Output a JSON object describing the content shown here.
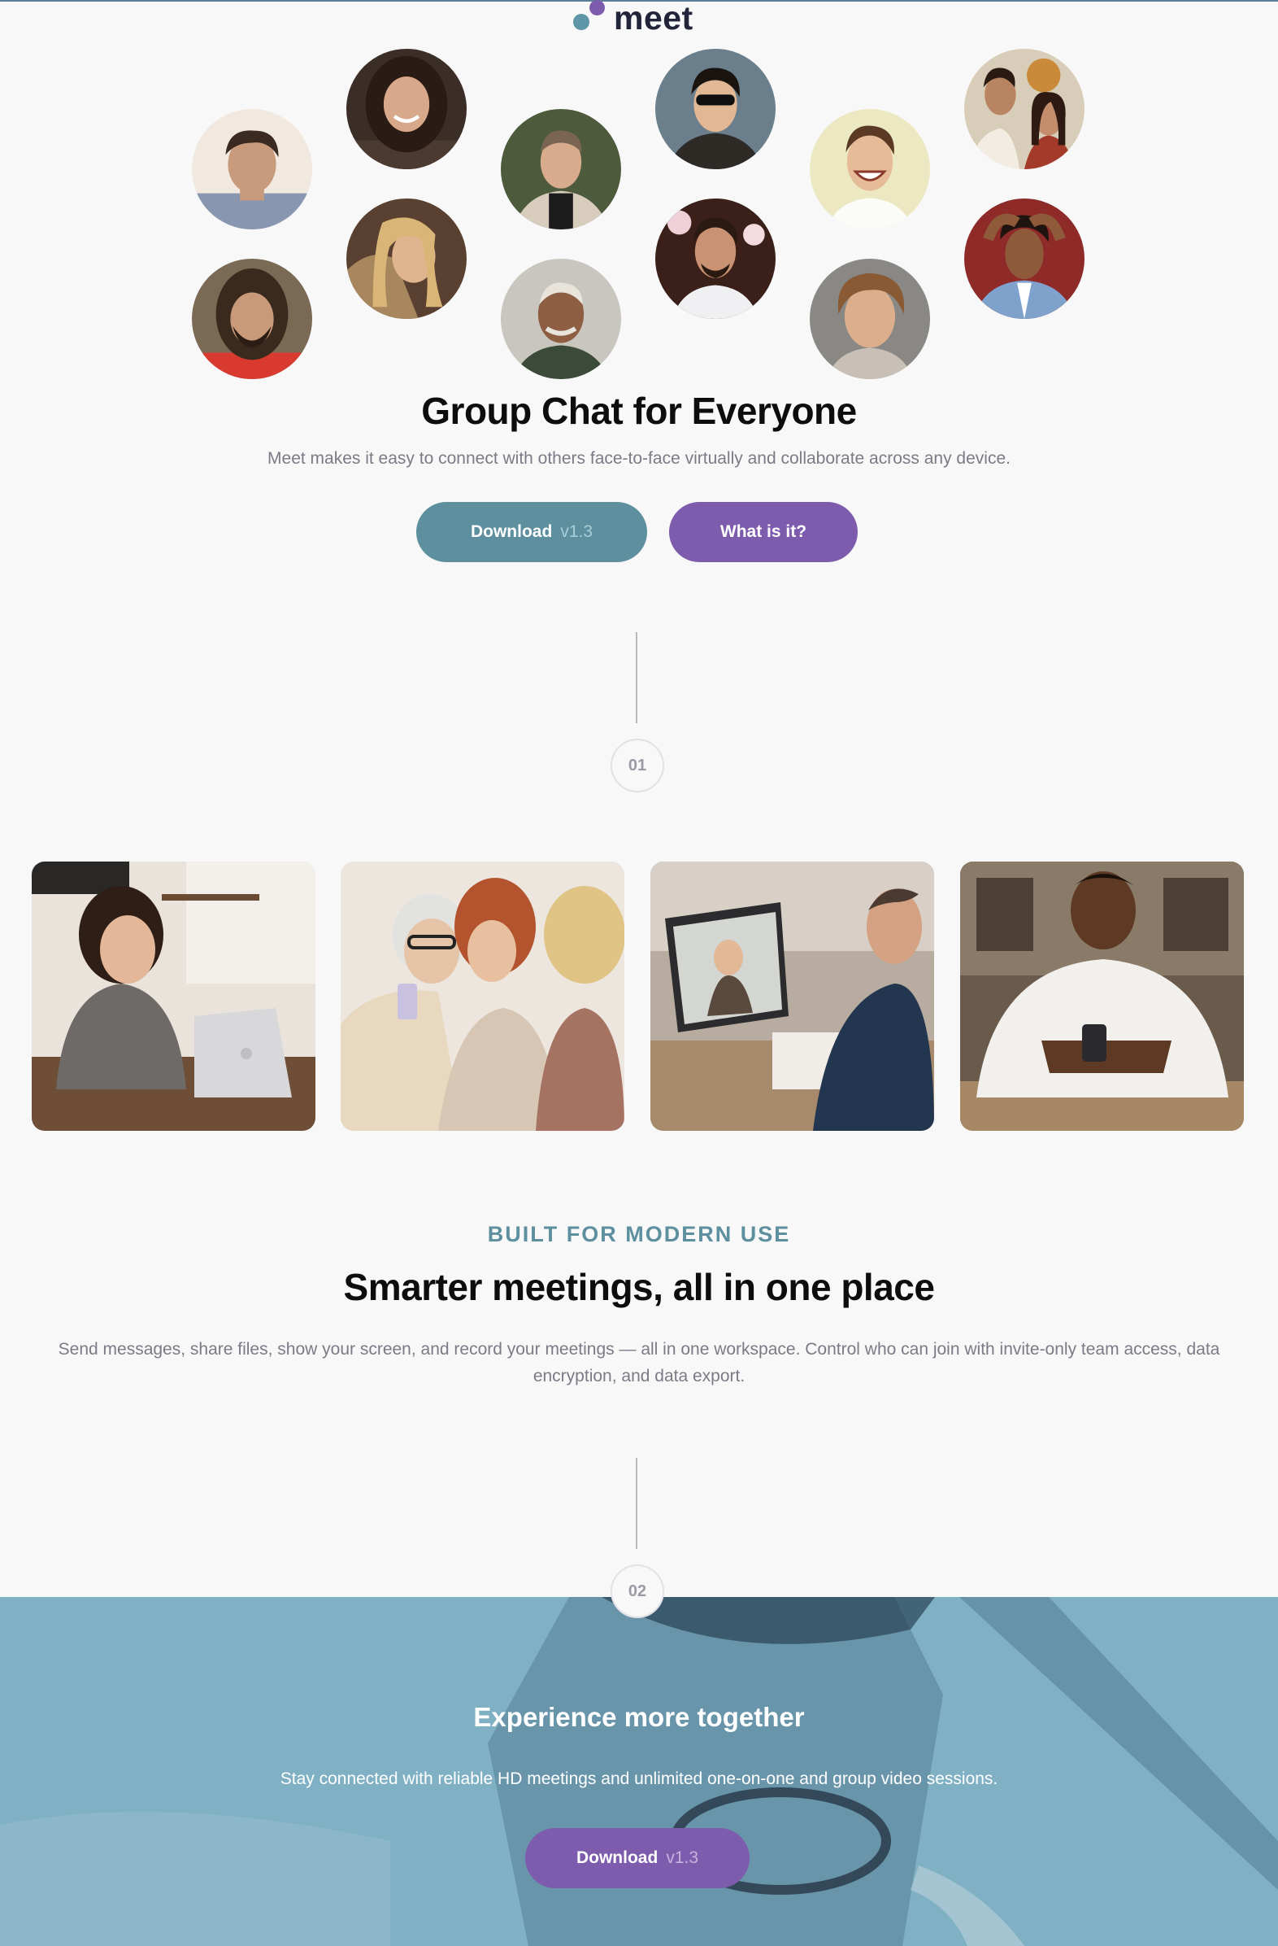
{
  "brand": {
    "name": "meet"
  },
  "colors": {
    "teal": "#5d8f9e",
    "purple": "#7e5cad",
    "navy": "#22253a",
    "banner": "#6ea4b8"
  },
  "hero": {
    "title": "Group Chat for Everyone",
    "subtitle": "Meet makes it easy to connect with others face-to-face virtually and collaborate across any device.",
    "download_label": "Download",
    "download_version": "v1.3",
    "what_label": "What is it?"
  },
  "steps": [
    "01",
    "02"
  ],
  "features": {
    "eyebrow": "BUILT FOR MODERN USE",
    "title": "Smarter meetings, all in one place",
    "body": "Send messages, share files, show your screen, and record your meetings — all in one workspace. Control who can join with invite-only team access, data encryption, and data export."
  },
  "banner": {
    "title": "Experience more together",
    "subtitle": "Stay connected with reliable HD meetings and unlimited one-on-one and group video sessions.",
    "download_label": "Download",
    "download_version": "v1.3"
  }
}
